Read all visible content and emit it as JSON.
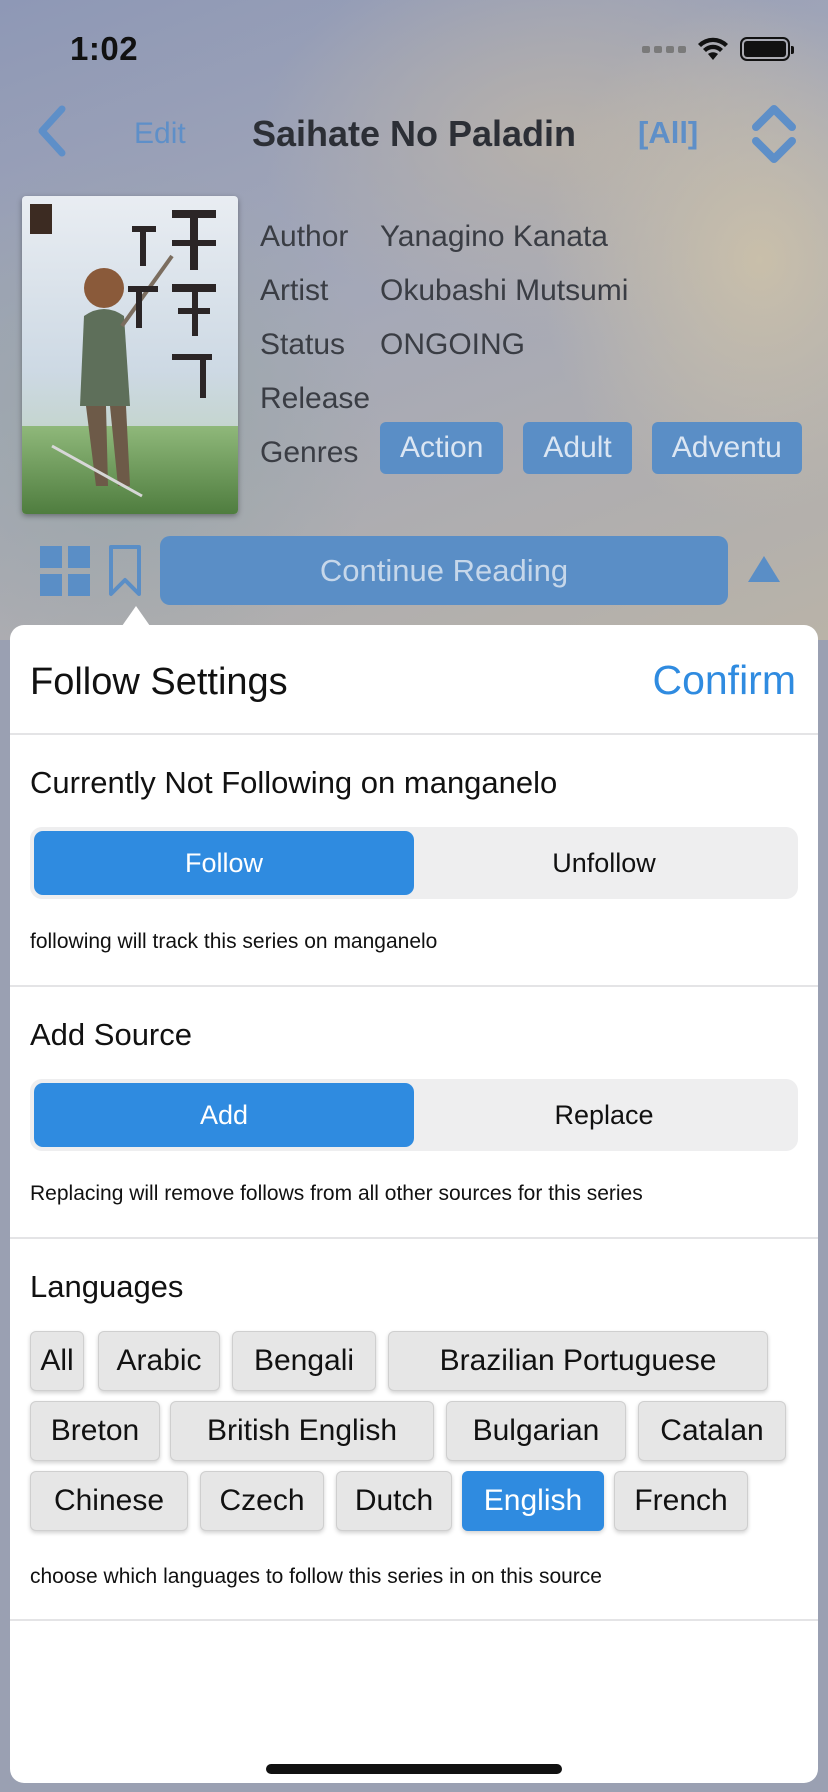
{
  "status_bar": {
    "time": "1:02"
  },
  "nav": {
    "edit_label": "Edit",
    "title": "Saihate No Paladin",
    "all_label": "[All]"
  },
  "details": {
    "author_label": "Author",
    "author": "Yanagino Kanata",
    "artist_label": "Artist",
    "artist": "Okubashi Mutsumi",
    "status_label": "Status",
    "status": "ONGOING",
    "release_label": "Release",
    "release": "",
    "genres_label": "Genres",
    "genres": [
      "Action",
      "Adult",
      "Adventu"
    ]
  },
  "actions": {
    "continue_label": "Continue Reading"
  },
  "sheet": {
    "title": "Follow Settings",
    "confirm_label": "Confirm",
    "follow_section": {
      "title": "Currently Not Following on  manganelo",
      "options": [
        "Follow",
        "Unfollow"
      ],
      "selected": "Follow",
      "note": "following will track this series on manganelo"
    },
    "source_section": {
      "title": "Add Source",
      "options": [
        "Add",
        "Replace"
      ],
      "selected": "Add",
      "note": "Replacing will remove follows from all other sources for this series"
    },
    "languages_section": {
      "title": "Languages",
      "languages": [
        "All",
        "Arabic",
        "Bengali",
        "Brazilian Portuguese",
        "Breton",
        "British English",
        "Bulgarian",
        "Catalan",
        "Chinese",
        "Czech",
        "Dutch",
        "English",
        "French"
      ],
      "selected": [
        "English"
      ],
      "note": "choose which languages to follow this series in on this source"
    }
  },
  "colors": {
    "accent": "#2f8be0",
    "muted_accent": "#5a8ec6",
    "segment_bg": "#eeeeef"
  }
}
